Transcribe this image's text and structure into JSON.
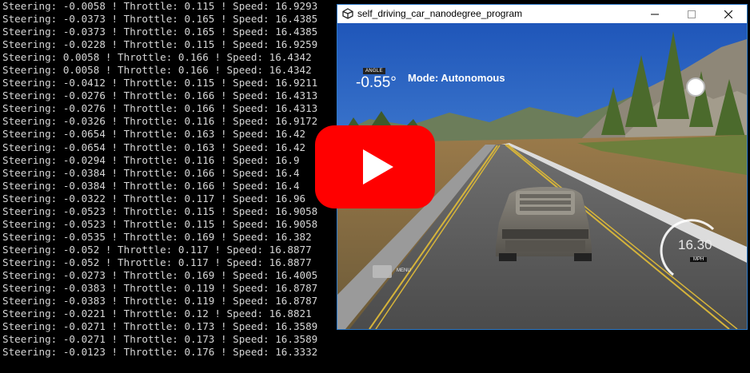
{
  "console": {
    "lines": [
      "Steering: -0.0058 ! Throttle: 0.115 ! Speed: 16.9293",
      "Steering: -0.0373 ! Throttle: 0.165 ! Speed: 16.4385",
      "Steering: -0.0373 ! Throttle: 0.165 ! Speed: 16.4385",
      "Steering: -0.0228 ! Throttle: 0.115 ! Speed: 16.9259",
      "Steering: 0.0058 ! Throttle: 0.166 ! Speed: 16.4342",
      "Steering: 0.0058 ! Throttle: 0.166 ! Speed: 16.4342",
      "Steering: -0.0412 ! Throttle: 0.115 ! Speed: 16.9211",
      "Steering: -0.0276 ! Throttle: 0.166 ! Speed: 16.4313",
      "Steering: -0.0276 ! Throttle: 0.166 ! Speed: 16.4313",
      "Steering: -0.0326 ! Throttle: 0.116 ! Speed: 16.9172",
      "Steering: -0.0654 ! Throttle: 0.163 ! Speed: 16.42",
      "Steering: -0.0654 ! Throttle: 0.163 ! Speed: 16.42",
      "Steering: -0.0294 ! Throttle: 0.116 ! Speed: 16.9",
      "Steering: -0.0384 ! Throttle: 0.166 ! Speed: 16.4",
      "Steering: -0.0384 ! Throttle: 0.166 ! Speed: 16.4",
      "Steering: -0.0322 ! Throttle: 0.117 ! Speed: 16.96",
      "Steering: -0.0523 ! Throttle: 0.115 ! Speed: 16.9058",
      "Steering: -0.0523 ! Throttle: 0.115 ! Speed: 16.9058",
      "Steering: -0.0535 ! Throttle: 0.169 ! Speed: 16.382",
      "Steering: -0.052 ! Throttle: 0.117 ! Speed: 16.8877",
      "Steering: -0.052 ! Throttle: 0.117 ! Speed: 16.8877",
      "Steering: -0.0273 ! Throttle: 0.169 ! Speed: 16.4005",
      "Steering: -0.0383 ! Throttle: 0.119 ! Speed: 16.8787",
      "Steering: -0.0383 ! Throttle: 0.119 ! Speed: 16.8787",
      "Steering: -0.0221 ! Throttle: 0.12 ! Speed: 16.8821",
      "Steering: -0.0271 ! Throttle: 0.173 ! Speed: 16.3589",
      "Steering: -0.0271 ! Throttle: 0.173 ! Speed: 16.3589",
      "Steering: -0.0123 ! Throttle: 0.176 ! Speed: 16.3332"
    ]
  },
  "window": {
    "title": "self_driving_car_nanodegree_program",
    "icon": "unity-icon",
    "controls": [
      "minimize-icon",
      "maximize-icon",
      "close-icon"
    ]
  },
  "hud": {
    "angle_tag": "ANGLE",
    "angle_value": "-0.55°",
    "mode": "Mode: Autonomous",
    "speed_value": "16.30",
    "speed_unit": "MPH",
    "menu_label": "MENU"
  },
  "overlay": {
    "icon": "play-icon",
    "color": "#ff0000"
  }
}
